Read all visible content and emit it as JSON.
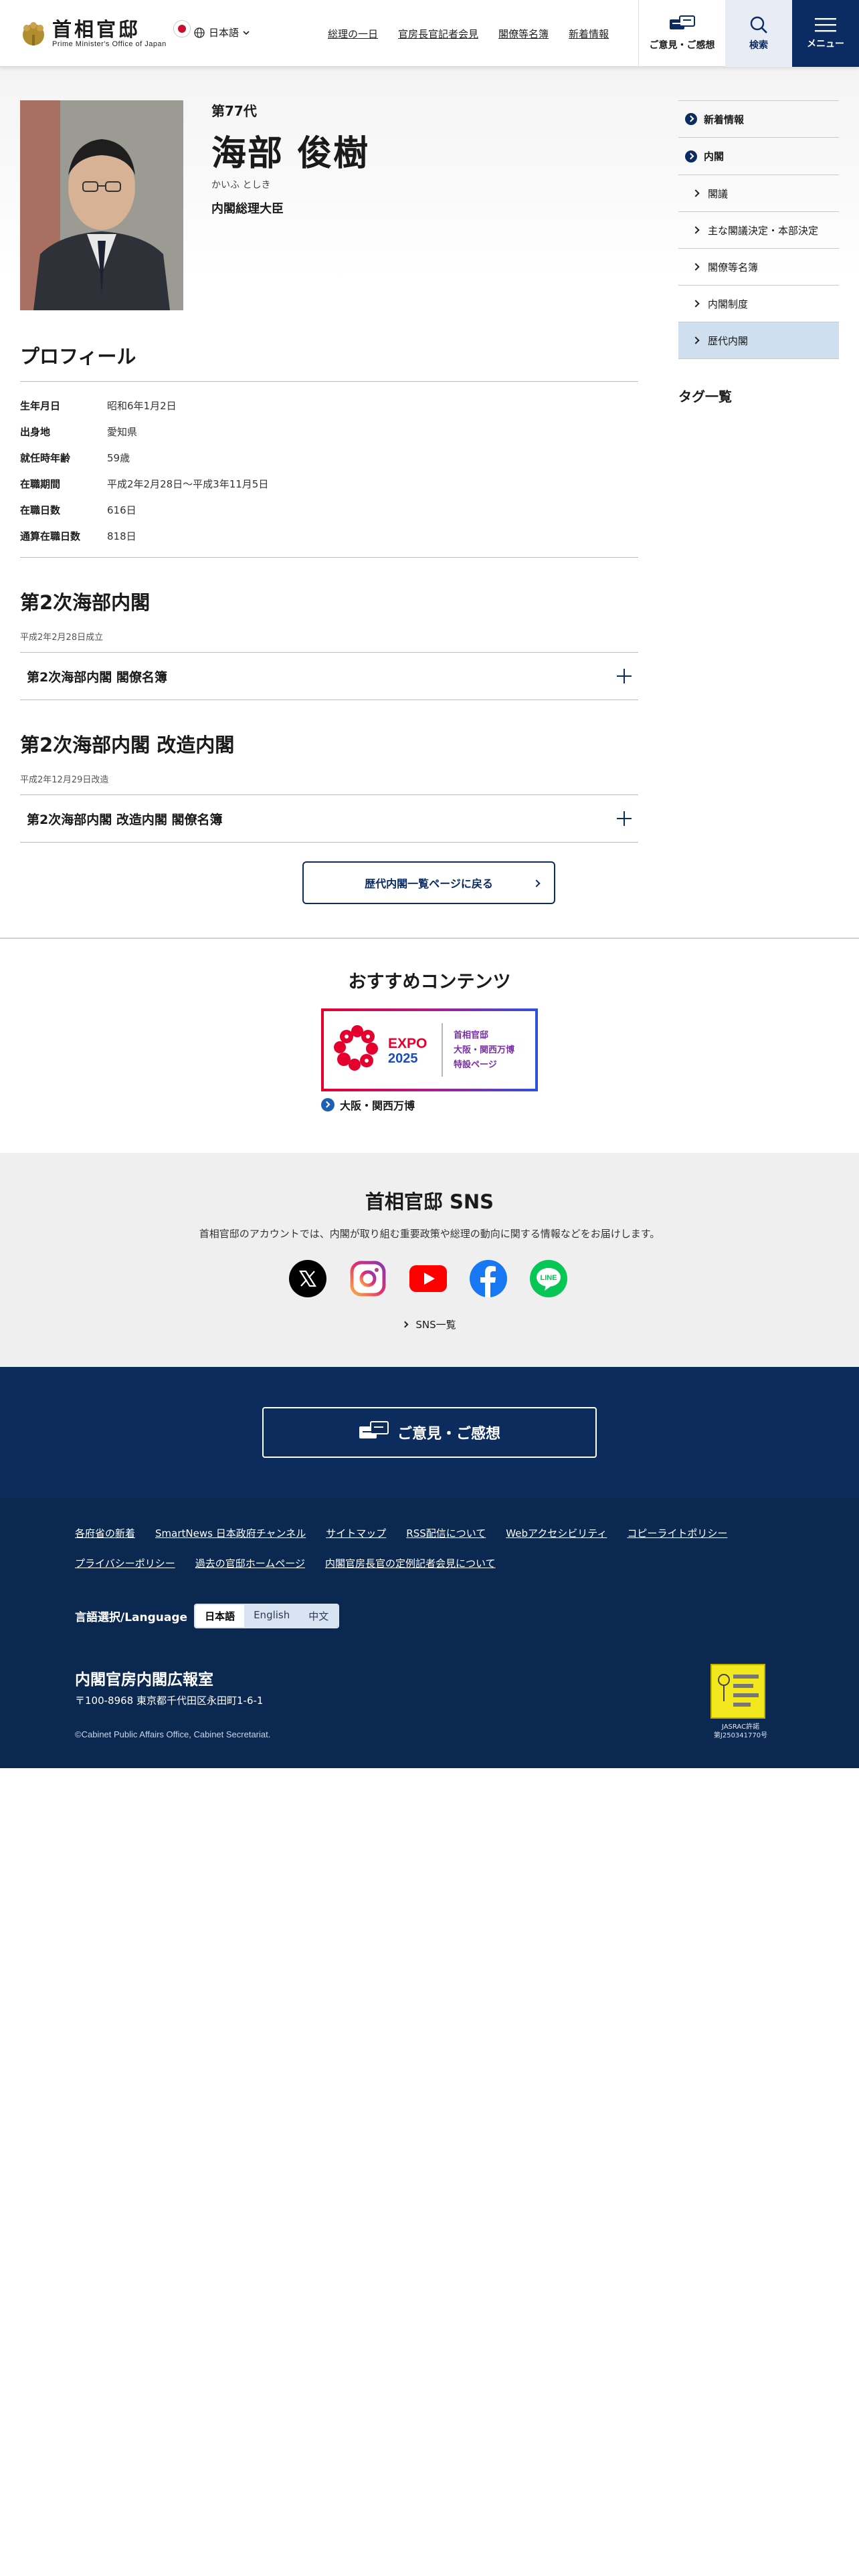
{
  "header": {
    "logo_jp": "首相官邸",
    "logo_en": "Prime Minister's Office of Japan",
    "language": "日本語",
    "nav": [
      "総理の一日",
      "官房長官記者会見",
      "閣僚等名簿",
      "新着情報"
    ],
    "opinion_label": "ご意見・ご感想",
    "search_label": "検索",
    "menu_label": "メニュー"
  },
  "hero": {
    "generation": "第77代",
    "name": "海部 俊樹",
    "kana": "かいふ としき",
    "title": "内閣総理大臣"
  },
  "profile": {
    "heading": "プロフィール",
    "rows": [
      {
        "k": "生年月日",
        "v": "昭和6年1月2日"
      },
      {
        "k": "出身地",
        "v": "愛知県"
      },
      {
        "k": "就任時年齢",
        "v": "59歳"
      },
      {
        "k": "在職期間",
        "v": "平成2年2月28日～平成3年11月5日"
      },
      {
        "k": "在職日数",
        "v": "616日"
      },
      {
        "k": "通算在職日数",
        "v": "818日"
      }
    ]
  },
  "cabinets": [
    {
      "title": "第2次海部内閣",
      "date": "平成2年2月28日成立",
      "accordion": "第2次海部内閣 閣僚名簿"
    },
    {
      "title": "第2次海部内閣 改造内閣",
      "date": "平成2年12月29日改造",
      "accordion": "第2次海部内閣 改造内閣 閣僚名簿"
    }
  ],
  "back_button": "歴代内閣一覧ページに戻る",
  "sidebar": {
    "items": [
      {
        "label": "新着情報",
        "type": "top"
      },
      {
        "label": "内閣",
        "type": "top"
      },
      {
        "label": "閣議",
        "type": "sub"
      },
      {
        "label": "主な閣議決定・本部決定",
        "type": "sub"
      },
      {
        "label": "閣僚等名簿",
        "type": "sub"
      },
      {
        "label": "内閣制度",
        "type": "sub"
      },
      {
        "label": "歴代内閣",
        "type": "sub-active"
      }
    ],
    "tags_title": "タグ一覧"
  },
  "recommended": {
    "title": "おすすめコンテンツ",
    "banner_word": "EXPO",
    "banner_year": "2025",
    "banner_lines": [
      "首相官邸",
      "大阪・関西万博",
      "特設ページ"
    ],
    "label": "大阪・関西万博"
  },
  "sns": {
    "title": "首相官邸 SNS",
    "desc": "首相官邸のアカウントでは、内閣が取り組む重要政策や総理の動向に関する情報などをお届けします。",
    "icons": [
      "x-icon",
      "instagram-icon",
      "youtube-icon",
      "facebook-icon",
      "line-icon"
    ],
    "line_text": "LINE",
    "list_label": "SNS一覧"
  },
  "opinion": {
    "label": "ご意見・ご感想"
  },
  "footer": {
    "links": [
      "各府省の新着",
      "SmartNews 日本政府チャンネル",
      "サイトマップ",
      "RSS配信について",
      "Webアクセシビリティ",
      "コピーライトポリシー",
      "プライバシーポリシー",
      "過去の官邸ホームページ",
      "内閣官房長官の定例記者会見について"
    ],
    "lang_label": "言語選択/Language",
    "langs": [
      "日本語",
      "English",
      "中文"
    ],
    "org": "内閣官房内閣広報室",
    "address": "〒100-8968 東京都千代田区永田町1-6-1",
    "copyright": "©Cabinet Public Affairs Office, Cabinet Secretariat.",
    "jasrac_lines": [
      "JASRAC許諾",
      "第J250341770号"
    ]
  },
  "colors": {
    "navy": "#0a2c63",
    "footer": "#0a2850",
    "active": "#cfdff0"
  }
}
